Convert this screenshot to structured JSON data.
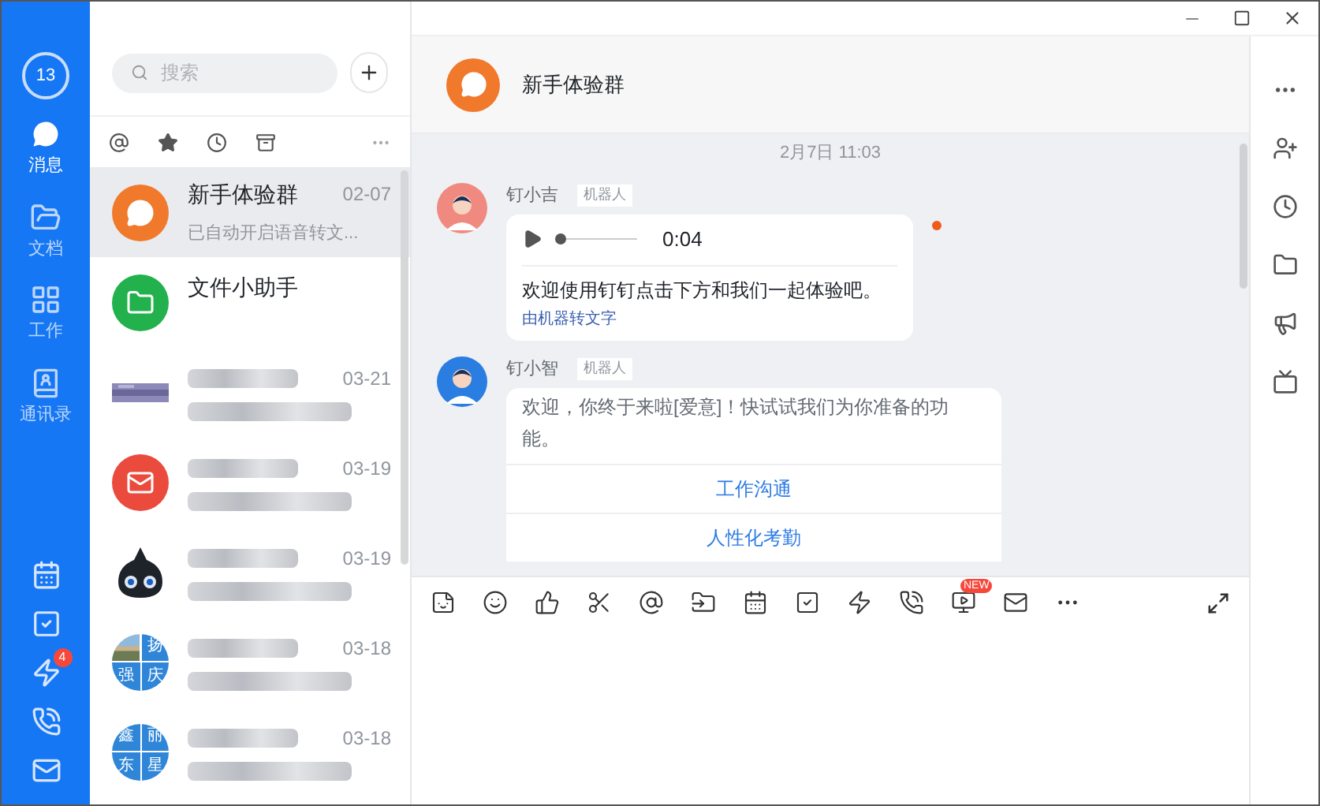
{
  "nav": {
    "avatar_label": "13",
    "items": [
      {
        "kind": "message",
        "label": "消息",
        "selected": true
      },
      {
        "kind": "docs",
        "label": "文档",
        "selected": false
      },
      {
        "kind": "work",
        "label": "工作",
        "selected": false
      },
      {
        "kind": "contacts",
        "label": "通讯录",
        "selected": false
      }
    ],
    "tools": [
      {
        "kind": "calendar"
      },
      {
        "kind": "todo"
      },
      {
        "kind": "ding",
        "badge": "4"
      },
      {
        "kind": "phone"
      },
      {
        "kind": "mail"
      }
    ]
  },
  "chat_list": {
    "search_placeholder": "搜索",
    "chats": [
      {
        "kind": "bot",
        "name": "新手体验群",
        "time": "02-07",
        "preview": "已自动开启语音转文...",
        "selected": true,
        "redacted": false
      },
      {
        "kind": "folder",
        "name": "文件小助手",
        "selected": false,
        "redacted": false
      },
      {
        "kind": "picture",
        "time": "03-21",
        "selected": false,
        "redacted": true
      },
      {
        "kind": "mail",
        "time": "03-19",
        "selected": false,
        "redacted": true
      },
      {
        "kind": "mascot",
        "time": "03-19",
        "selected": false,
        "redacted": true
      },
      {
        "kind": "group",
        "avatar_chars": [
          "扬",
          "强",
          "庆"
        ],
        "time": "03-18",
        "selected": false,
        "redacted": true
      },
      {
        "kind": "group",
        "avatar_chars": [
          "鑫",
          "丽",
          "东",
          "星"
        ],
        "time": "03-18",
        "selected": false,
        "redacted": true
      }
    ]
  },
  "conversation": {
    "title": "新手体验群",
    "date": "2月7日 11:03",
    "messages": [
      {
        "kind": "voice",
        "sender": "钉小吉",
        "tag": "机器人",
        "color": "#f08a80",
        "duration": "0:04",
        "level": 0,
        "text": "欢迎使用钉钉点击下方和我们一起体验吧。",
        "caption": "由机器转文字",
        "unread": true
      },
      {
        "kind": "card",
        "sender": "钉小智",
        "tag": "机器人",
        "color": "#2a7de1",
        "text": "欢迎，你终于来啦[爱意]！快试试我们为你准备的功能。",
        "links": [
          "工作沟通",
          "人性化考勤"
        ]
      }
    ]
  },
  "toolbar": {
    "new_badge": "NEW"
  }
}
